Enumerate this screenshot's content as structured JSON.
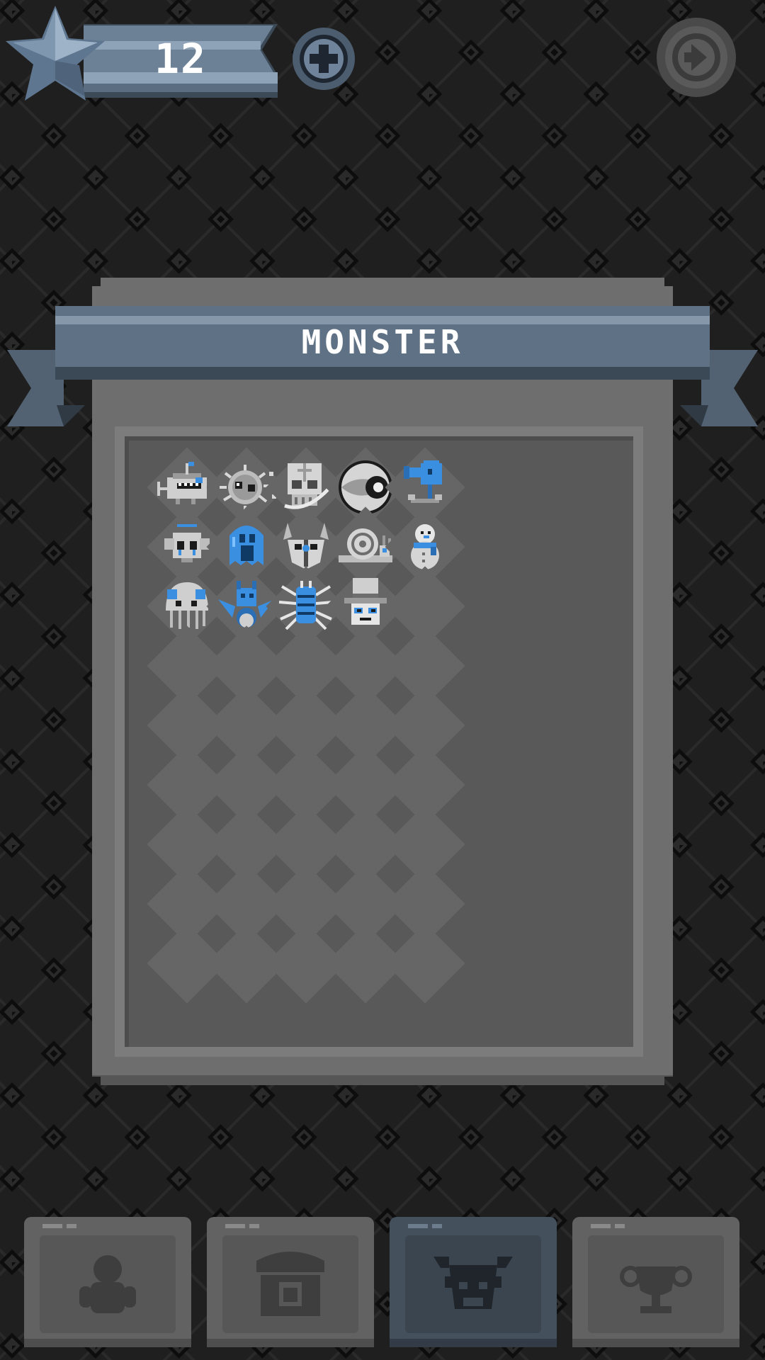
{
  "header": {
    "star_count": "12",
    "icons": {
      "currency": "star-icon",
      "add": "plus-icon",
      "exit": "exit-icon"
    }
  },
  "panel": {
    "title": "MONSTER",
    "monsters": [
      {
        "name": "anglerfish-monster",
        "icon": "anglerfish-icon"
      },
      {
        "name": "dust-mite-monster",
        "icon": "fuzzy-ball-icon"
      },
      {
        "name": "skull-monster",
        "icon": "skull-icon"
      },
      {
        "name": "eyeball-monster",
        "icon": "eyeball-icon"
      },
      {
        "name": "plant-monster",
        "icon": "pea-shooter-icon"
      },
      {
        "name": "angel-bulb-monster",
        "icon": "halo-bulb-icon"
      },
      {
        "name": "ghost-monster",
        "icon": "ghost-icon"
      },
      {
        "name": "horned-helmet-monster",
        "icon": "horned-helmet-icon"
      },
      {
        "name": "snail-monster",
        "icon": "snail-icon"
      },
      {
        "name": "snowman-monster",
        "icon": "snowman-icon"
      },
      {
        "name": "jellyfish-monster",
        "icon": "jellyfish-icon"
      },
      {
        "name": "dragon-monster",
        "icon": "dragon-icon"
      },
      {
        "name": "spider-monster",
        "icon": "spider-icon"
      },
      {
        "name": "top-hat-monster",
        "icon": "top-hat-icon"
      }
    ],
    "grid": {
      "columns": 5,
      "rows": 10,
      "filled": 14
    }
  },
  "tabs": [
    {
      "name": "tab-character",
      "icon": "character-icon",
      "active": false
    },
    {
      "name": "tab-shop",
      "icon": "shop-icon",
      "active": false
    },
    {
      "name": "tab-monster",
      "icon": "monster-icon",
      "active": true
    },
    {
      "name": "tab-trophy",
      "icon": "trophy-icon",
      "active": false
    }
  ],
  "colors": {
    "background": "#1f1f1f",
    "accent_blue": "#3a8fe0",
    "ribbon": "#5f7184",
    "panel": "#6e6e6e",
    "active_tab": "#44505c"
  }
}
